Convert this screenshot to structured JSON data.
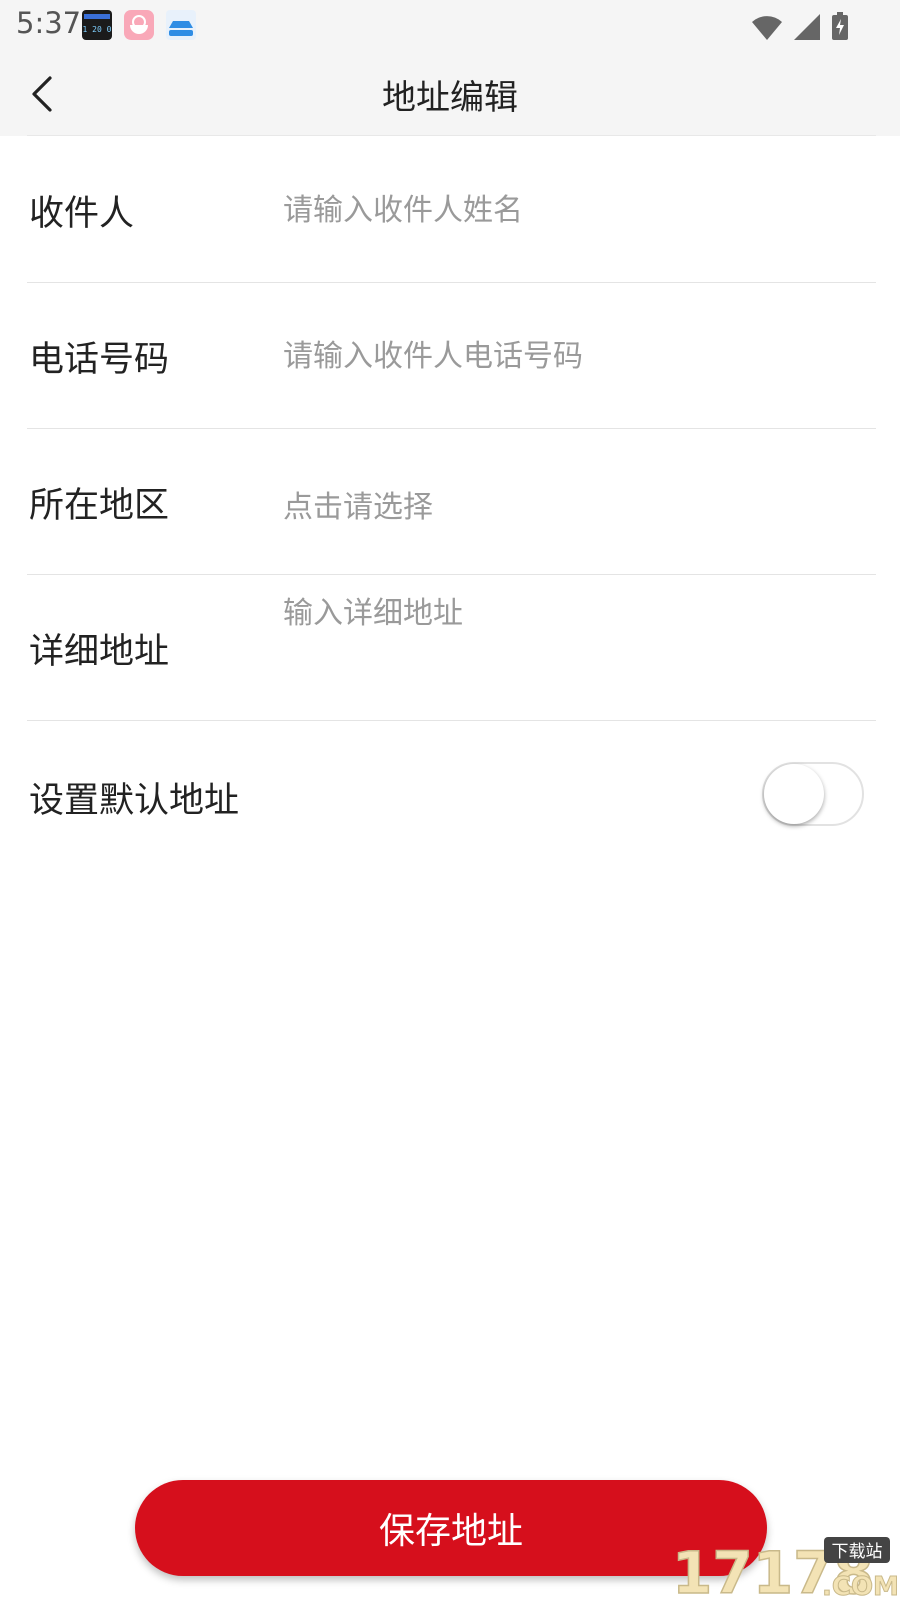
{
  "status_bar": {
    "time": "5:37",
    "notification_icons": [
      "clock-widget-icon",
      "rice-bowl-app-icon",
      "car-app-icon"
    ],
    "system_icons": [
      "wifi-icon",
      "signal-icon",
      "battery-charging-icon"
    ]
  },
  "header": {
    "title": "地址编辑",
    "back_icon": "chevron-left-icon"
  },
  "form": {
    "recipient": {
      "label": "收件人",
      "placeholder": "请输入收件人姓名",
      "value": ""
    },
    "phone": {
      "label": "电话号码",
      "placeholder": "请输入收件人电话号码",
      "value": ""
    },
    "region": {
      "label": "所在地区",
      "placeholder": "点击请选择"
    },
    "detail": {
      "label": "详细地址",
      "placeholder": "输入详细地址",
      "value": ""
    },
    "default_address": {
      "label": "设置默认地址",
      "enabled": false
    }
  },
  "save_button": {
    "label": "保存地址"
  },
  "colors": {
    "accent": "#d60f1c",
    "header_bg": "#f5f5f5",
    "divider": "#e4e4e4",
    "placeholder": "#9a9a9a",
    "text": "#222222"
  },
  "watermark": {
    "text": "17178",
    "sub": "下载站",
    "suffix": ".COM"
  }
}
